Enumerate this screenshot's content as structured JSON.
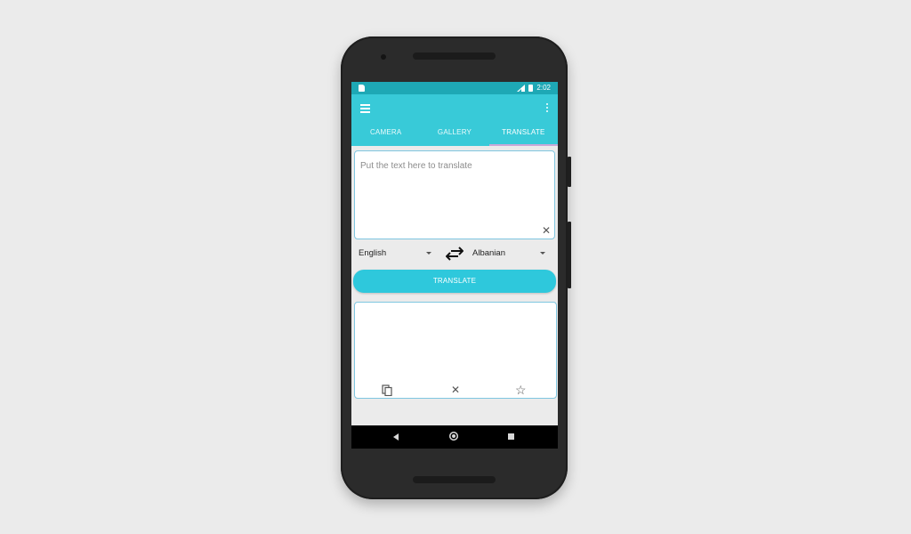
{
  "status_bar": {
    "time": "2:02",
    "icons": [
      "sim-icon",
      "signal-icon",
      "battery-icon"
    ]
  },
  "app_bar": {
    "menu_icon": "menu-icon",
    "overflow_icon": "more-vert-icon",
    "tabs": [
      {
        "label": "CAMERA",
        "active": false
      },
      {
        "label": "GALLERY",
        "active": false
      },
      {
        "label": "TRANSLATE",
        "active": true
      }
    ]
  },
  "input": {
    "placeholder": "Put the text here to translate",
    "value": "",
    "clear_icon": "close-icon"
  },
  "languages": {
    "source": "English",
    "target": "Albanian",
    "swap_icon": "swap-horiz-icon"
  },
  "translate_button": {
    "label": "TRANSLATE"
  },
  "output": {
    "value": "",
    "icons": [
      "copy-icon",
      "close-icon",
      "star-outline-icon"
    ]
  },
  "colors": {
    "status_bar": "#1ea8b5",
    "app_bar": "#38cad8",
    "accent": "#2ec8dc",
    "tab_indicator": "#c8a8d8",
    "border": "#7fc6e0"
  }
}
